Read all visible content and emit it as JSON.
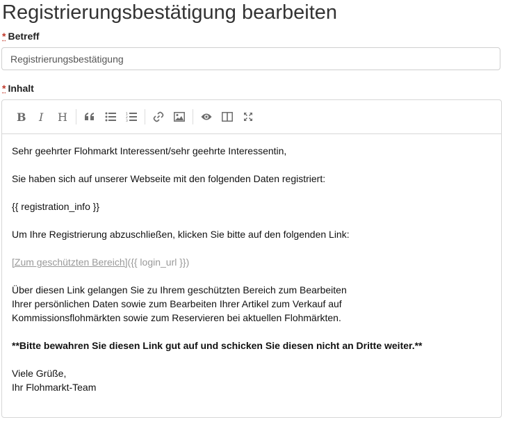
{
  "page": {
    "title": "Registrierungsbestätigung bearbeiten"
  },
  "form": {
    "subject": {
      "required_marker": "*",
      "label": "Betreff",
      "value": "Registrierungsbestätigung"
    },
    "content": {
      "required_marker": "*",
      "label": "Inhalt"
    }
  },
  "toolbar": {
    "buttons": [
      {
        "name": "bold",
        "icon": "bold-icon"
      },
      {
        "name": "italic",
        "icon": "italic-icon"
      },
      {
        "name": "heading",
        "icon": "heading-icon"
      },
      {
        "name": "quote",
        "icon": "quote-icon"
      },
      {
        "name": "unordered-list",
        "icon": "unordered-list-icon"
      },
      {
        "name": "ordered-list",
        "icon": "ordered-list-icon"
      },
      {
        "name": "link",
        "icon": "link-icon"
      },
      {
        "name": "image",
        "icon": "image-icon"
      },
      {
        "name": "preview",
        "icon": "eye-icon"
      },
      {
        "name": "side-by-side",
        "icon": "columns-icon"
      },
      {
        "name": "fullscreen",
        "icon": "fullscreen-icon"
      }
    ]
  },
  "editor": {
    "greeting": "Sehr geehrter Flohmarkt Interessent/sehr geehrte Interessentin,",
    "intro": "Sie haben sich auf unserer Webseite mit den folgenden Daten registriert:",
    "registration_placeholder": "{{ registration_info }}",
    "instruction": "Um Ihre Registrierung abzuschließen, klicken Sie bitte auf den folgenden Link:",
    "link_text": "[Zum geschützten Bereich]",
    "link_url": "({{ login_url }})",
    "info_line1": "Über diesen Link gelangen Sie zu Ihrem geschützten Bereich zum Bearbeiten",
    "info_line2": "Ihrer persönlichen Daten sowie zum Bearbeiten Ihrer Artikel zum Verkauf auf",
    "info_line3": "Kommissionsflohmärkten sowie zum Reservieren bei aktuellen Flohmärkten.",
    "warning": "**Bitte bewahren Sie diesen Link gut auf und schicken Sie diesen nicht an Dritte weiter.**",
    "closing": "Viele Grüße,",
    "signature": "Ihr Flohmarkt-Team"
  }
}
